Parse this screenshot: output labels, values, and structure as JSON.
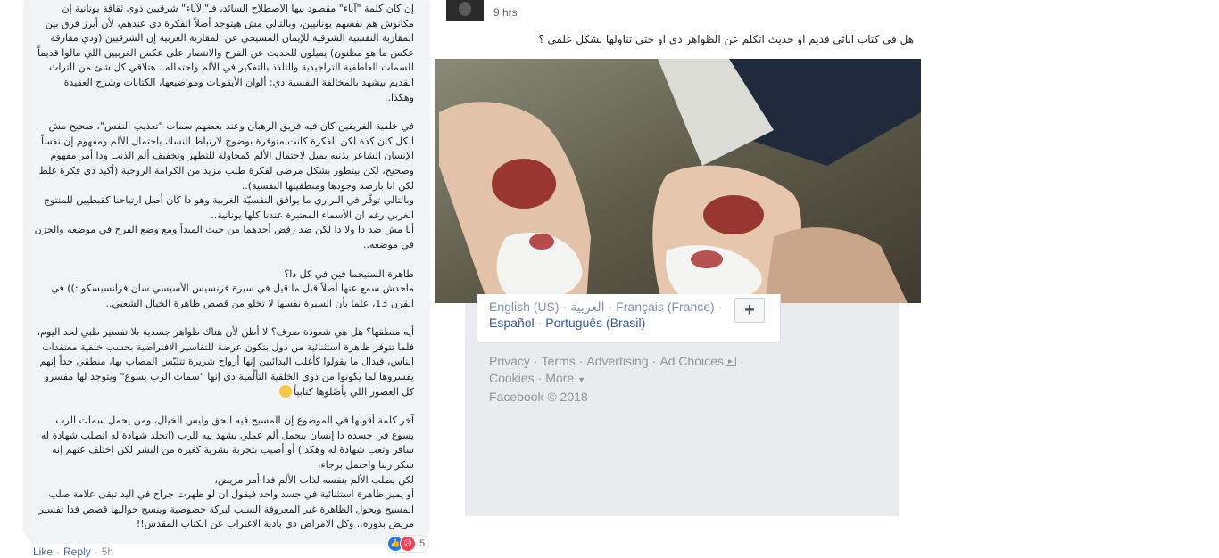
{
  "comment": {
    "paragraphs": [
      "إن كان كلمة \"آباء\" مقصود بيها الاصطلاح السائد، فـ\"الآباء\" شرقيين ذوي ثقافة يونانية إن مكانوش هم نفسهم يونانيين، وبالتالي مش هيتوجد أصلاً الفكرة دي عندهم، لأن أبرز فرق بين المقاربة النفسية الشرقية للإيمان المسيحي عن المقاربة الغربية إن الشرقيين (ودي مفارقة عكس ما هو مظنون) يميلون للحديث عن الفرح والانتصار على عكس الغربيين اللي مالوا قديماً للسمات العاطفية التراجيدية والتلذذ بالتفكير في الألم واحتماله.. هتلاقي كل شئ من التراث القديم بيشهد بالمخالفة النفسية دي: ألوان الأيقونات ومواضيعها، الكتابات وشرح العقيدة وهكذا..",
      "في خلفية الفريقين كان فيه فريق الرهبان وعند بعضهم سمات \"تعذيب النفس\"، صحيح مش الكل كان كدة لكن الفكرة كانت متوفرة بوضوح لارتباط النسك باحتمال الألم ومفهوم إن نفساً الإنسان الشاعر بذنبه يميل لاحتمال الألم كمحاولة للتطهر وتخفيف ألم الذنب ودا أمر مفهوم وصحيح، لكن بيتطور بشكل مرضي لفكرة طلب مزيد من الكرامة الروحية (أكيد دي فكرة غلط لكن انا بارصد وجودها ومنطقيتها النفسية)..\nوبالتالي توقّر في البراري ما يوافق النفسيّة الغربية وهو دا كان أصل ارتياحنا كقبطيين للمنتوج الغربي رغم ان الأسماء المعتبرة عندنا كلها يونانية..\nأنا مش ضد دا ولا دا لكن ضد رفض أحدهما من حيث المبدأ ومع وضع الفرح في موضعه والحزن في موضعه..",
      "ظاهرة الستيجما فين في كل دا؟\nماحدش سمع عنها أصلاً قبل ما قيل في سيرة فرنسيس الأسيسي سان فرانسيسكو :)) في القرن 13، علما بأن السيرة نفسها لا تخلو من قصص ظاهرة الخيال الشعبي..",
      "أيه منطقها؟ هل هي شعوذة صرف؟ لا أظن لأن هناك ظواهر جسدية بلا تفسير طبي لحد اليوم، فلما تتوفر ظاهرة استثنائية من دول بتكون عرضة للتفاسير الافتراضية بحسب خلفية معتقدات الناس، فبدال ما يقولوا كأغلب البدائيين إنها أرواح شريرة تتلبّس المصاب بها، منطقي جداً إنهم يفسروها لما يكونوا من ذوي الخلفية التألّمية دي إنها \"سمات الرب يسوع\" ويتوجد لها مفسرو كل العصور اللي يأصّلوها كتابياً",
      "آخر كلمة أقولها في الموضوع إن المسيح فيه الحق وليس الخيال، ومن يحمل سمات الرب يسوع في جسده دا إنسان بيحمل ألم عملي يشهد بيه للرب (اتجلد شهادة له اتصلب شهادة له سافر وتعب شهادة له وهكذا) أو أصيب بتجربة بشرية كغيره من البشر لكن اختلف عنهم إنه شكر ربنا واحتمل برجاء،\nلكن يطلب الألم بنفسه لذات الألم فدا أمر مريض،\nأو يميز ظاهرة استثنائية في جسد واحد فيقول ان لو ظهرت جراح في اليد تبقى علامة صلب المسيح ويحول الظاهرة غير المعروفة السبب لبركة خصوصية وينسج حواليها قصص فدا تفسير مريض بدوره.. وكل الامراض دي بادية الاغتراب عن الكتاب المقدس!!"
    ],
    "reaction_count": "5",
    "actions": {
      "like": "Like",
      "reply": "Reply",
      "time": "5h"
    }
  },
  "post": {
    "time": "9 hrs",
    "text": "هل في كتاب ابائي قديم او حديث اتكلم عن الظواهر دى او حتي تناولها بشكل علمي ؟",
    "image_icon": "photo-of-wounded-palms"
  },
  "sidebar": {
    "languages_row1": [
      "English (US)",
      "العربية",
      "Français (France)"
    ],
    "languages_row2": [
      "Español",
      "Português (Brasil)"
    ],
    "add_language": "+",
    "footer": {
      "privacy": "Privacy",
      "terms": "Terms",
      "advertising": "Advertising",
      "ad_choices": "Ad Choices",
      "cookies": "Cookies",
      "more": "More",
      "copyright": "Facebook © 2018"
    }
  },
  "colors": {
    "link": "#365899",
    "muted": "#90949c",
    "bubble": "#f2f3f5",
    "like_blue": "#1877f2",
    "sad_red": "#f33e58"
  }
}
